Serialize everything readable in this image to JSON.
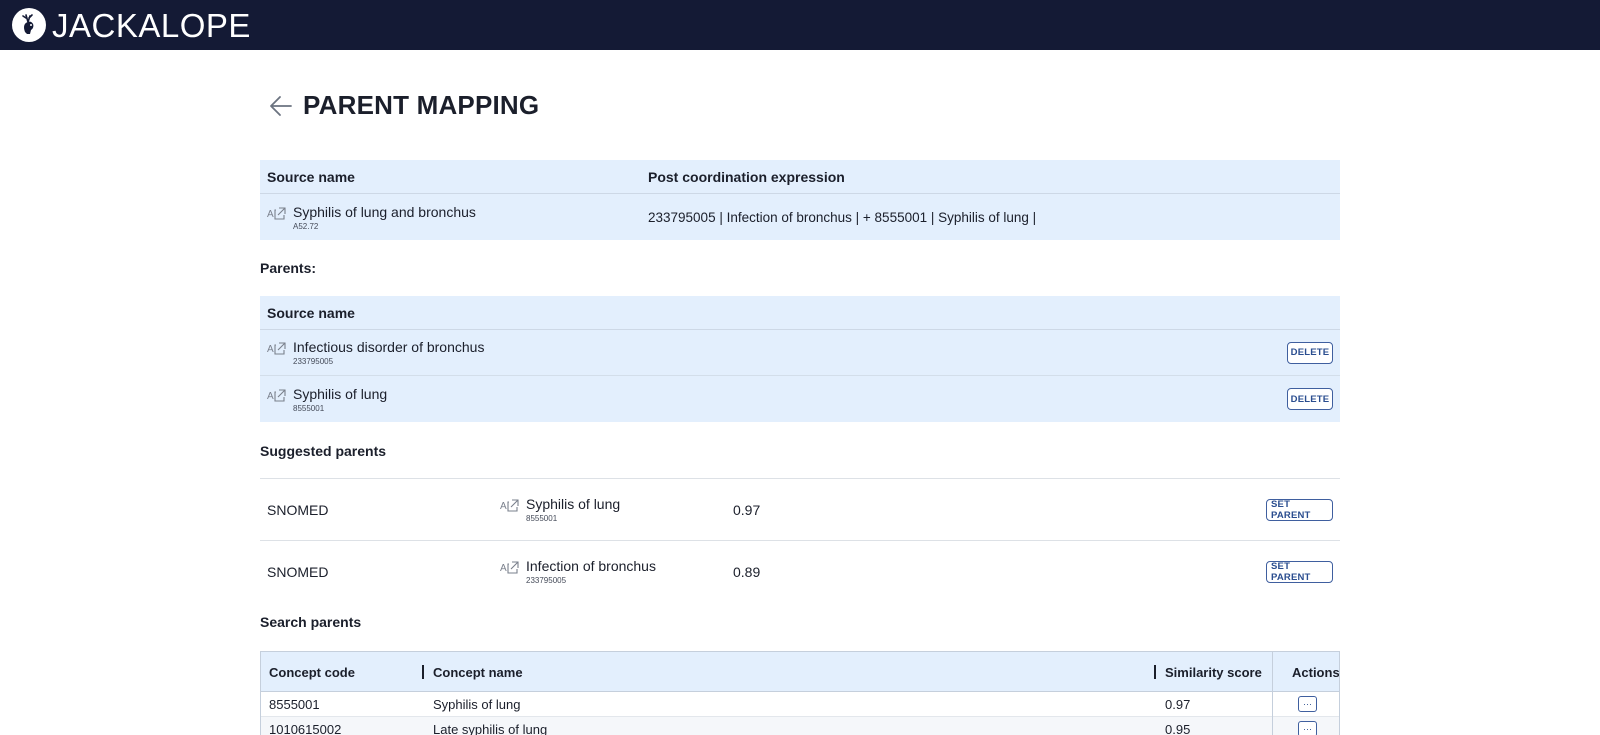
{
  "app": {
    "name": "JACKALOPE",
    "logo_icon": "jackalope-logo-icon"
  },
  "page": {
    "title": "PARENT MAPPING",
    "back_icon": "arrow-left-icon"
  },
  "source_panel": {
    "headers": {
      "source_name": "Source name",
      "post_coordination": "Post coordination expression"
    },
    "row": {
      "concept_name": "Syphilis of lung and bronchus",
      "concept_code": "A52.72",
      "expression": "233795005 | Infection of bronchus | + 8555001 | Syphilis of lung |"
    }
  },
  "parents": {
    "label": "Parents:",
    "header": "Source name",
    "items": [
      {
        "name": "Infectious disorder of bronchus",
        "code": "233795005",
        "action": "DELETE"
      },
      {
        "name": "Syphilis of lung",
        "code": "8555001",
        "action": "DELETE"
      }
    ]
  },
  "suggested": {
    "label": "Suggested parents",
    "items": [
      {
        "source": "SNOMED",
        "name": "Syphilis of lung",
        "code": "8555001",
        "score": "0.97",
        "action": "SET PARENT"
      },
      {
        "source": "SNOMED",
        "name": "Infection of bronchus",
        "code": "233795005",
        "score": "0.89",
        "action": "SET PARENT"
      }
    ]
  },
  "search": {
    "label": "Search parents",
    "columns": {
      "code": "Concept code",
      "name": "Concept name",
      "score": "Similarity score",
      "actions": "Actions"
    },
    "rows": [
      {
        "code": "8555001",
        "name": "Syphilis of lung",
        "score": "0.97",
        "action": "···"
      },
      {
        "code": "1010615002",
        "name": "Late syphilis of lung",
        "score": "0.95",
        "action": "···"
      }
    ]
  },
  "colors": {
    "topbar": "#141a35",
    "panel": "#e3effd",
    "button_border": "#3f5f9f",
    "button_text": "#2a4d8f"
  }
}
